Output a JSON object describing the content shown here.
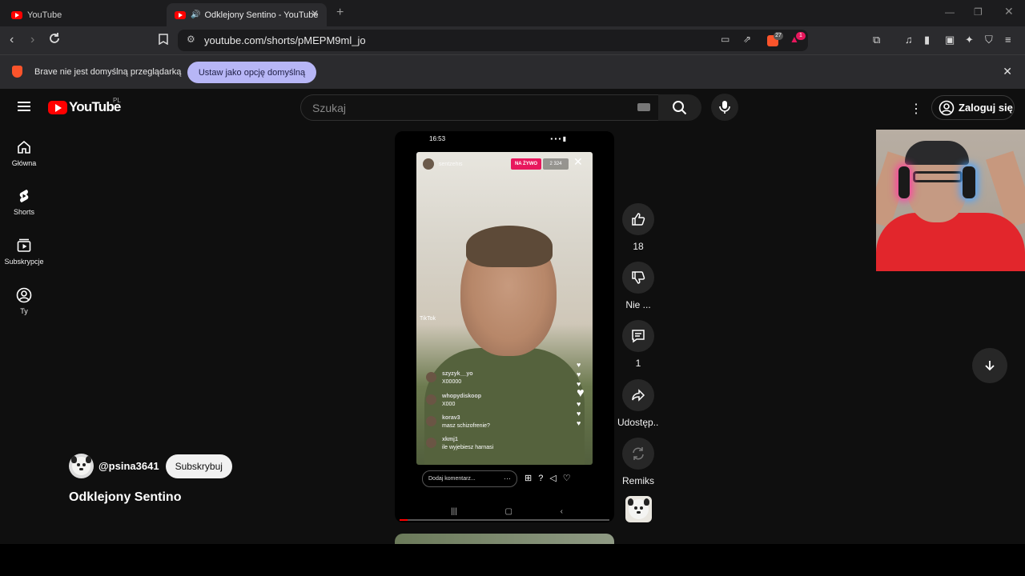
{
  "browser": {
    "tabs": [
      {
        "title": "YouTube"
      },
      {
        "title": "Odklejony Sentino - YouTube"
      }
    ],
    "address": "youtube.com/shorts/pMEPM9ml_jo",
    "shield_count": "27",
    "rewards_count": "1",
    "infobar": {
      "message": "Brave nie jest domyślną przeglądarką",
      "button": "Ustaw jako opcję domyślną"
    }
  },
  "youtube": {
    "logo_text": "YouTube",
    "country_code": "PL",
    "search_placeholder": "Szukaj",
    "signin_label": "Zaloguj się",
    "sidebar": [
      {
        "label": "Główna",
        "icon": "home-icon"
      },
      {
        "label": "Shorts",
        "icon": "shorts-icon"
      },
      {
        "label": "Subskrypcje",
        "icon": "subscriptions-icon"
      },
      {
        "label": "Ty",
        "icon": "you-icon"
      }
    ],
    "short": {
      "channel": "@psina3641",
      "subscribe_label": "Subskrybuj",
      "title": "Odklejony Sentino",
      "actions": {
        "like_count": "18",
        "dislike_label": "Nie ...",
        "comments_count": "1",
        "share_label": "Udostęp...",
        "remix_label": "Remiks"
      },
      "progress": 0.04
    },
    "video_frame": {
      "status_time": "16:53",
      "live_badge": "NA ŻYWO",
      "viewers": "2 324",
      "streamer": "sentzehis",
      "watermark": "TikTok",
      "comments": [
        {
          "user": "szyzyk__yo",
          "text": "X00000"
        },
        {
          "user": "whopydiskoop",
          "text": "X000"
        },
        {
          "user": "korav3",
          "text": "masz schizofrenie?"
        },
        {
          "user": "xkmj1",
          "text": "ile wyjebiesz harnasi"
        }
      ],
      "comment_placeholder": "Dodaj komentarz..."
    }
  }
}
